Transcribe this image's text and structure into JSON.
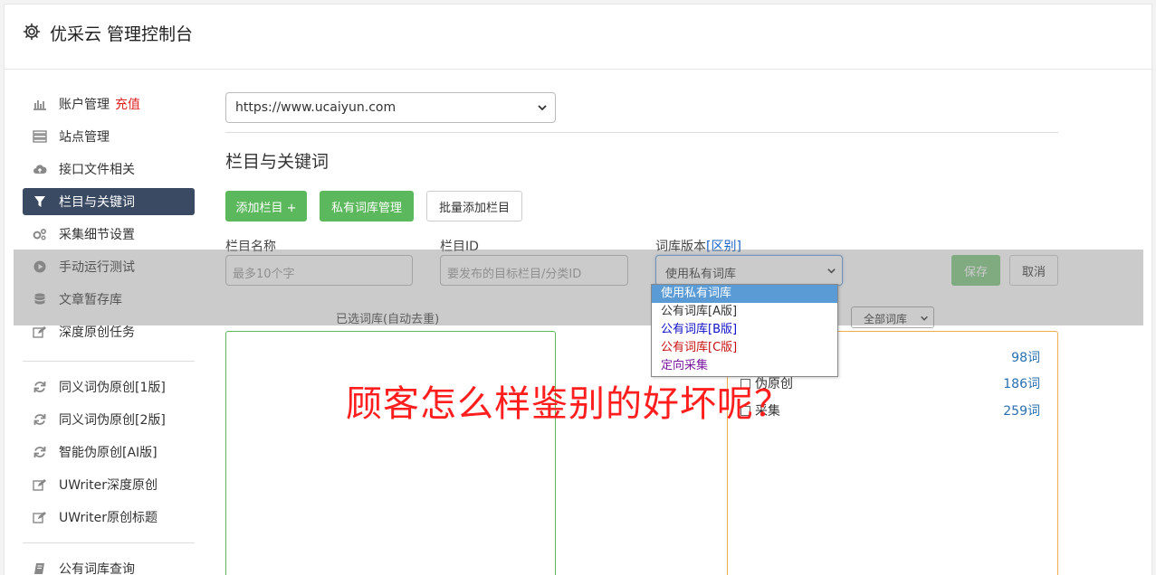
{
  "header": {
    "title": "优采云 管理控制台",
    "icon": "gear-icon"
  },
  "sidebar": {
    "items": [
      {
        "label": "账户管理",
        "extra": "充值",
        "icon": "bar-chart-icon"
      },
      {
        "label": "站点管理",
        "icon": "server-icon"
      },
      {
        "label": "接口文件相关",
        "icon": "cloud-upload-icon"
      },
      {
        "label": "栏目与关键词",
        "icon": "filter-icon",
        "active": true
      },
      {
        "label": "采集细节设置",
        "icon": "cogs-icon"
      },
      {
        "label": "手动运行测试",
        "icon": "play-circle-icon"
      },
      {
        "label": "文章暂存库",
        "icon": "database-icon"
      },
      {
        "label": "深度原创任务",
        "icon": "edit-icon"
      },
      {
        "label": "同义词伪原创[1版]",
        "icon": "refresh-icon"
      },
      {
        "label": "同义词伪原创[2版]",
        "icon": "refresh-icon"
      },
      {
        "label": "智能伪原创[AI版]",
        "icon": "refresh-icon"
      },
      {
        "label": "UWriter深度原创",
        "icon": "edit-icon"
      },
      {
        "label": "UWriter原创标题",
        "icon": "edit-icon"
      },
      {
        "label": "公有词库查询",
        "icon": "book-icon"
      }
    ]
  },
  "main": {
    "site_select": {
      "value": "https://www.ucaiyun.com"
    },
    "section_title": "栏目与关键词",
    "buttons": {
      "add_column": "添加栏目 +",
      "private_lib": "私有词库管理",
      "batch_add": "批量添加栏目",
      "save": "保存",
      "cancel": "取消"
    },
    "form": {
      "name_label": "栏目名称",
      "name_placeholder": "最多10个字",
      "id_label": "栏目ID",
      "id_placeholder": "要发布的目标栏目/分类ID",
      "version_label": "词库版本",
      "version_link": "[区别]",
      "version_value": "使用私有词库"
    },
    "dropdown_options": [
      "使用私有词库",
      "公有词库[A版]",
      "公有词库[B版]",
      "公有词库[C版]",
      "定向采集"
    ],
    "dropdown_colors": [
      "#ffffff",
      "#333333",
      "#1010c8",
      "#c81010",
      "#7a1aa0"
    ],
    "selected_lib_label": "已选词库(自动去重)",
    "filter_select": "全部词库",
    "lib_rows": [
      {
        "name": "",
        "count": "98词"
      },
      {
        "name": "伪原创",
        "count": "186词"
      },
      {
        "name": "采集",
        "count": "259词"
      }
    ]
  },
  "watermark": "顾客怎么样鉴别的好坏呢？"
}
